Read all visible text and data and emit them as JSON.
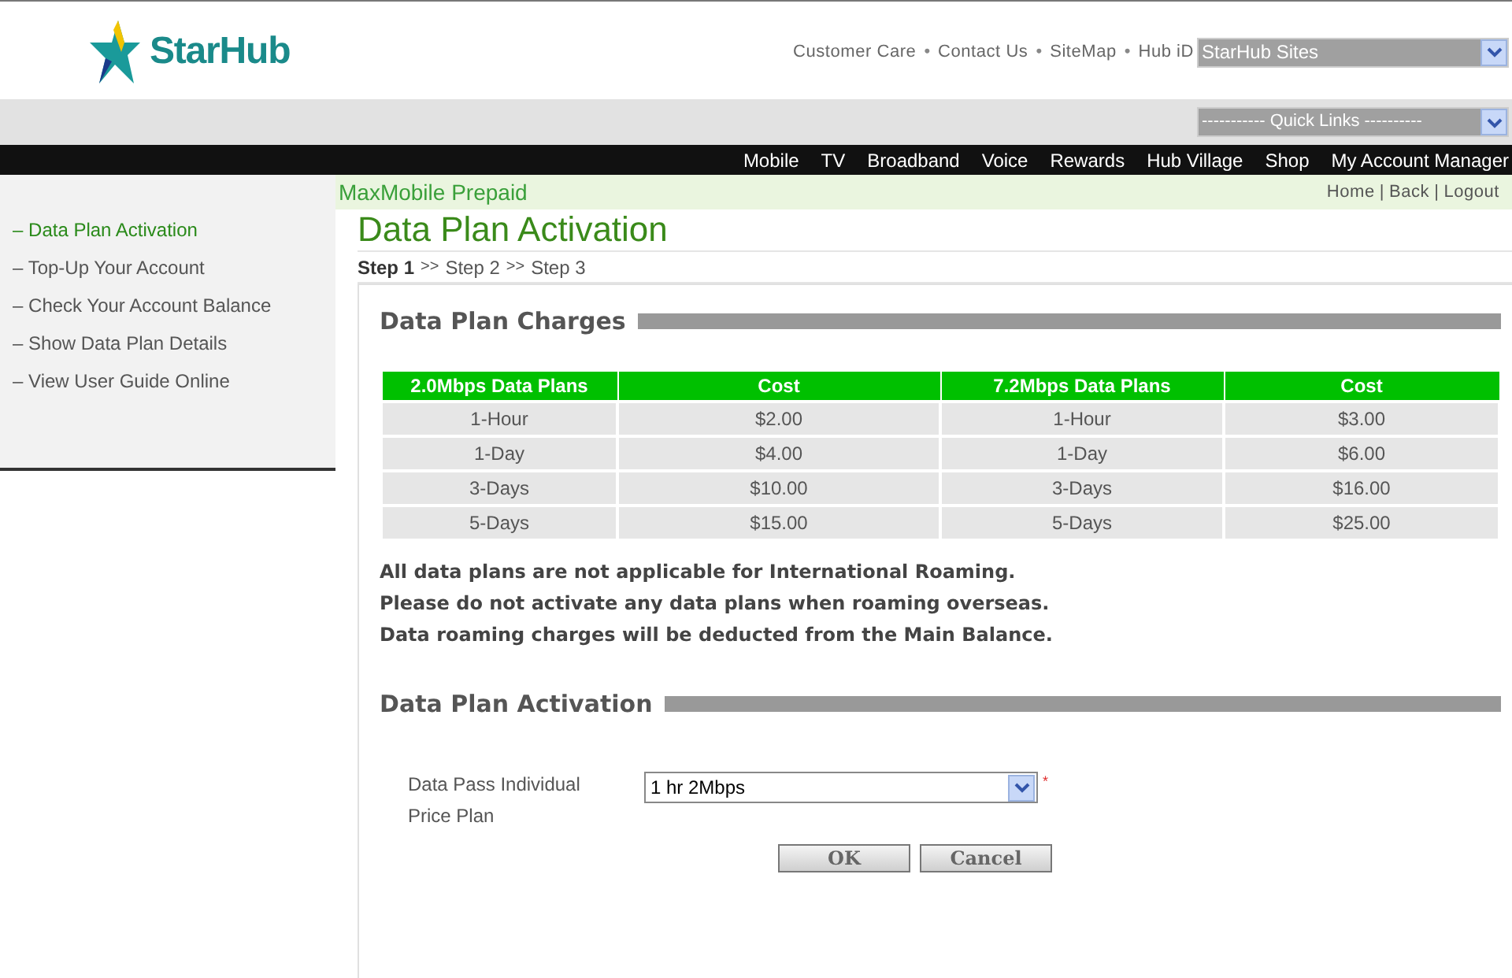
{
  "logo": {
    "text": "StarHub"
  },
  "top_links": [
    "Customer Care",
    "Contact Us",
    "SiteMap",
    "Hub iD"
  ],
  "top_link_separator": "•",
  "sidebar_bullet": "–",
  "utility_separator": "|",
  "sites_select": {
    "value": "StarHub Sites"
  },
  "quick_links_select": {
    "value": "----------- Quick Links ----------"
  },
  "nav": [
    "Mobile",
    "TV",
    "Broadband",
    "Voice",
    "Rewards",
    "Hub Village",
    "Shop",
    "My Account Manager"
  ],
  "section_title": "MaxMobile Prepaid",
  "utility_links": [
    "Home",
    "Back",
    "Logout"
  ],
  "sidebar": {
    "items": [
      {
        "label": "Data Plan Activation",
        "selected": true
      },
      {
        "label": "Top-Up Your Account",
        "selected": false
      },
      {
        "label": "Check Your Account Balance",
        "selected": false
      },
      {
        "label": "Show Data Plan Details",
        "selected": false
      },
      {
        "label": "View User Guide Online",
        "selected": false
      }
    ]
  },
  "page_title": "Data Plan Activation",
  "steps": [
    {
      "label": "Step 1",
      "selected": true
    },
    {
      "label": "Step 2",
      "selected": false
    },
    {
      "label": "Step 3",
      "selected": false
    }
  ],
  "step_separator": ">>",
  "charges": {
    "heading": "Data Plan Charges",
    "table": {
      "columns": [
        "2.0Mbps Data Plans",
        "Cost",
        "7.2Mbps Data Plans",
        "Cost"
      ],
      "rows": [
        [
          "1-Hour",
          "$2.00",
          "1-Hour",
          "$3.00"
        ],
        [
          "1-Day",
          "$4.00",
          "1-Day",
          "$6.00"
        ],
        [
          "3-Days",
          "$10.00",
          "3-Days",
          "$16.00"
        ],
        [
          "5-Days",
          "$15.00",
          "5-Days",
          "$25.00"
        ]
      ]
    }
  },
  "notes": [
    "All data plans are not applicable for International Roaming.",
    "Please do not activate any data plans when roaming overseas.",
    "Data roaming charges will be deducted from the Main Balance."
  ],
  "activation": {
    "heading": "Data Plan Activation",
    "field": {
      "label": "Data Pass Individual Price Plan",
      "value": "1 hr 2Mbps",
      "required_mark": "*"
    },
    "buttons": [
      "OK",
      "Cancel"
    ]
  }
}
